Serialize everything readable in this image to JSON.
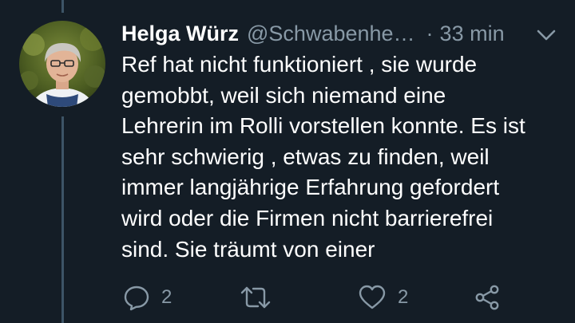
{
  "tweet": {
    "display_name": "Helga Würz",
    "handle": "@Schwabenhe…",
    "separator": "·",
    "timestamp": "33 min",
    "text": "Ref hat nicht funktioniert , sie wurde\ngemobbt, weil sich niemand eine\nLehrerin im Rolli vorstellen konnte. Es ist\nsehr schwierig , etwas zu finden, weil\nimmer langjährige Erfahrung gefordert\nwird oder die Firmen nicht barrierefrei\nsind. Sie träumt von einer"
  },
  "actions": {
    "reply_count": "2",
    "retweet_count": "",
    "like_count": "2"
  },
  "colors": {
    "background": "#141d26",
    "text_primary": "#ffffff",
    "text_secondary": "#8899a6",
    "thread_line": "#3d5466"
  },
  "icons": [
    "reply-icon",
    "retweet-icon",
    "like-icon",
    "share-icon",
    "chevron-down-icon"
  ]
}
